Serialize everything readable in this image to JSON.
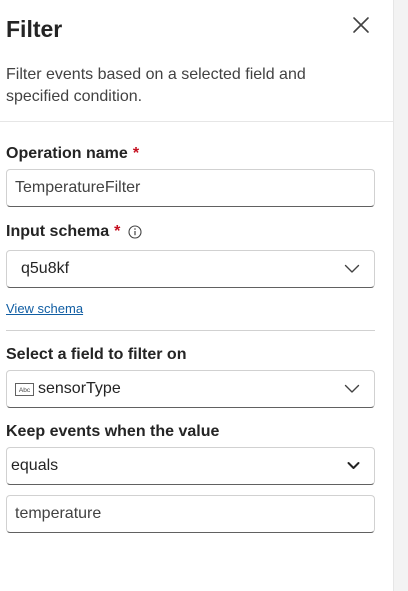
{
  "header": {
    "title": "Filter",
    "description": "Filter events based on a selected field and specified condition."
  },
  "operation_name": {
    "label": "Operation name",
    "required_mark": "*",
    "value": "TemperatureFilter"
  },
  "input_schema": {
    "label": "Input schema",
    "required_mark": "*",
    "selected": "q5u8kf",
    "view_schema_link": "View schema"
  },
  "filter_field": {
    "label": "Select a field to filter on",
    "selected": "sensorType",
    "type_icon": "abc-text-icon"
  },
  "condition": {
    "label": "Keep events when the value",
    "operator": "equals",
    "value": "temperature"
  },
  "colors": {
    "accent_link": "#115ea3",
    "required": "#c50f1f"
  }
}
